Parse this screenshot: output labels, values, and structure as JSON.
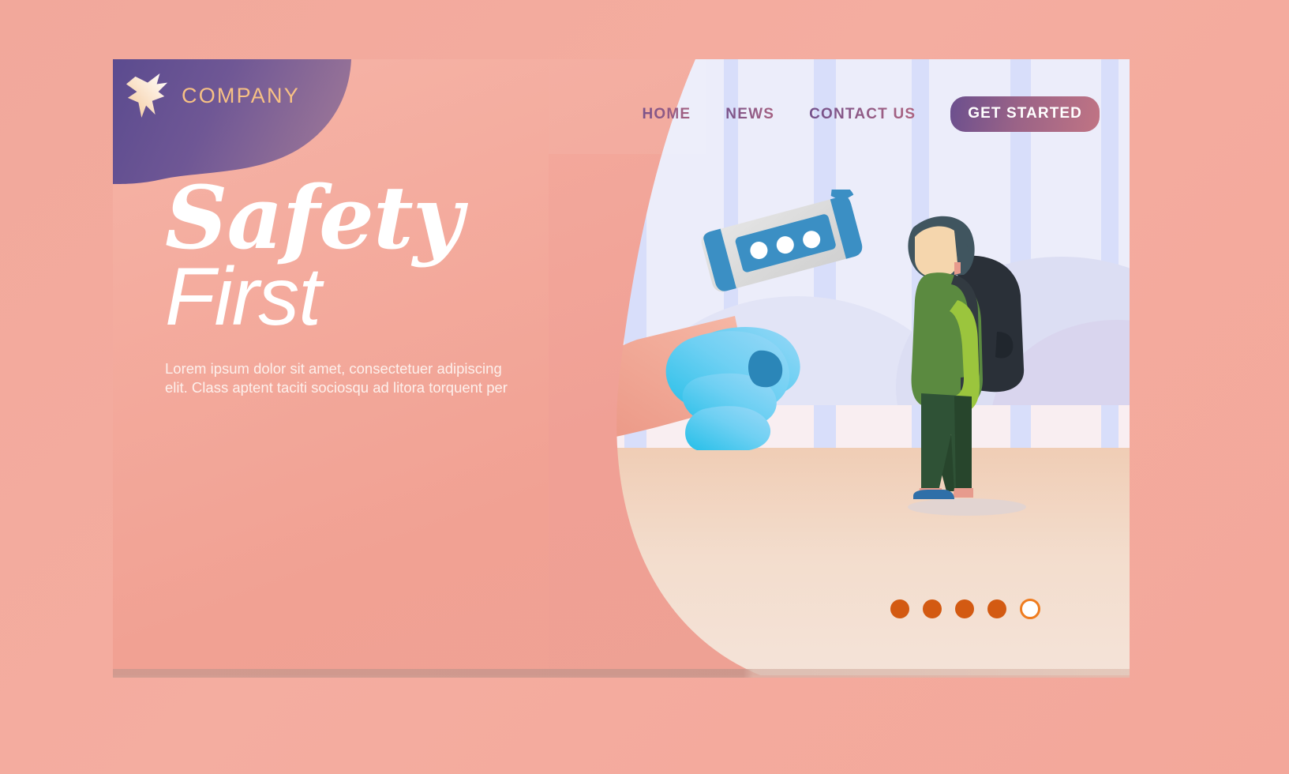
{
  "brand": {
    "name": "COMPANY",
    "logo_icon": "bird-star-logo-icon",
    "logo_gradient_from": "#5b4b8f",
    "logo_gradient_to": "#a77e98",
    "wordmark_color": "#f7c184"
  },
  "nav": {
    "items": [
      {
        "label": "HOME",
        "name": "nav-home"
      },
      {
        "label": "NEWS",
        "name": "nav-news"
      },
      {
        "label": "CONTACT US",
        "name": "nav-contact-us"
      }
    ],
    "cta_label": "GET STARTED",
    "cta_gradient_from": "#6b4f8e",
    "cta_gradient_to": "#c07484",
    "link_gradient_from": "#6b4f8e",
    "link_gradient_to": "#b5667e"
  },
  "hero": {
    "title_line1": "Safety",
    "title_line2": "First",
    "paragraph": "Lorem ipsum dolor sit amet, consectetuer adipiscing elit. Class aptent taciti sociosqu ad litora torquent per",
    "title_color": "#ffffff",
    "paragraph_color": "#fdf0ec",
    "panel_gradient_from": "#f6b4a7",
    "panel_gradient_to": "#efa295"
  },
  "illustration": {
    "description": "gloved-hand-holding-infrared-thermometer-aimed-at-man-with-backpack",
    "wall_color": "#ecedfa",
    "stripe_color": "#d8defa",
    "floor_gradient_from": "#f0cdb5",
    "floor_gradient_to": "#f4e3d8",
    "glove_gradient_from": "#2ec5e8",
    "glove_gradient_to": "#8fd6f5",
    "thermometer_body": "#dedede",
    "thermometer_accent": "#3b8fc4",
    "skin_color": "#f2b49f",
    "shirt_color_light": "#8fb73c",
    "shirt_color_dark": "#4f7a3d",
    "pants_color": "#2f5236",
    "backpack_color": "#2a3038",
    "hair_color": "#40555f",
    "shoe_color": "#2f6fa8"
  },
  "carousel": {
    "total": 5,
    "active_index": 5,
    "dot_color": "#d35a12",
    "active_dot_ring": "#ef7c1f",
    "active_dot_fill": "#ffffff"
  },
  "page": {
    "background_gradient_from": "#f2a89b",
    "background_gradient_to": "#f3a79a",
    "card_shadow_color": "#c7988e"
  }
}
